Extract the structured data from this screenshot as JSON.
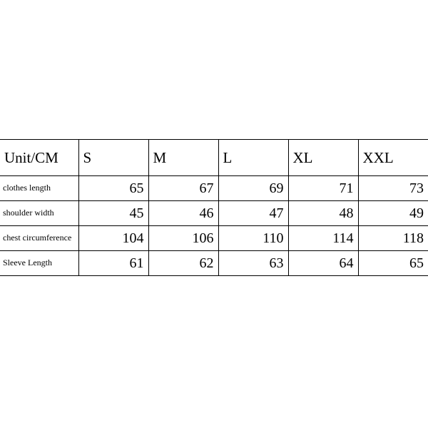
{
  "chart_data": {
    "type": "table",
    "title": "Unit/CM",
    "columns": [
      "S",
      "M",
      "L",
      "XL",
      "XXL"
    ],
    "rows": [
      {
        "label": "clothes length",
        "values": [
          65,
          67,
          69,
          71,
          73
        ]
      },
      {
        "label": "shoulder width",
        "values": [
          45,
          46,
          47,
          48,
          49
        ]
      },
      {
        "label": "chest circumference",
        "values": [
          104,
          106,
          110,
          114,
          118
        ]
      },
      {
        "label": "Sleeve Length",
        "values": [
          61,
          62,
          63,
          64,
          65
        ]
      }
    ]
  }
}
